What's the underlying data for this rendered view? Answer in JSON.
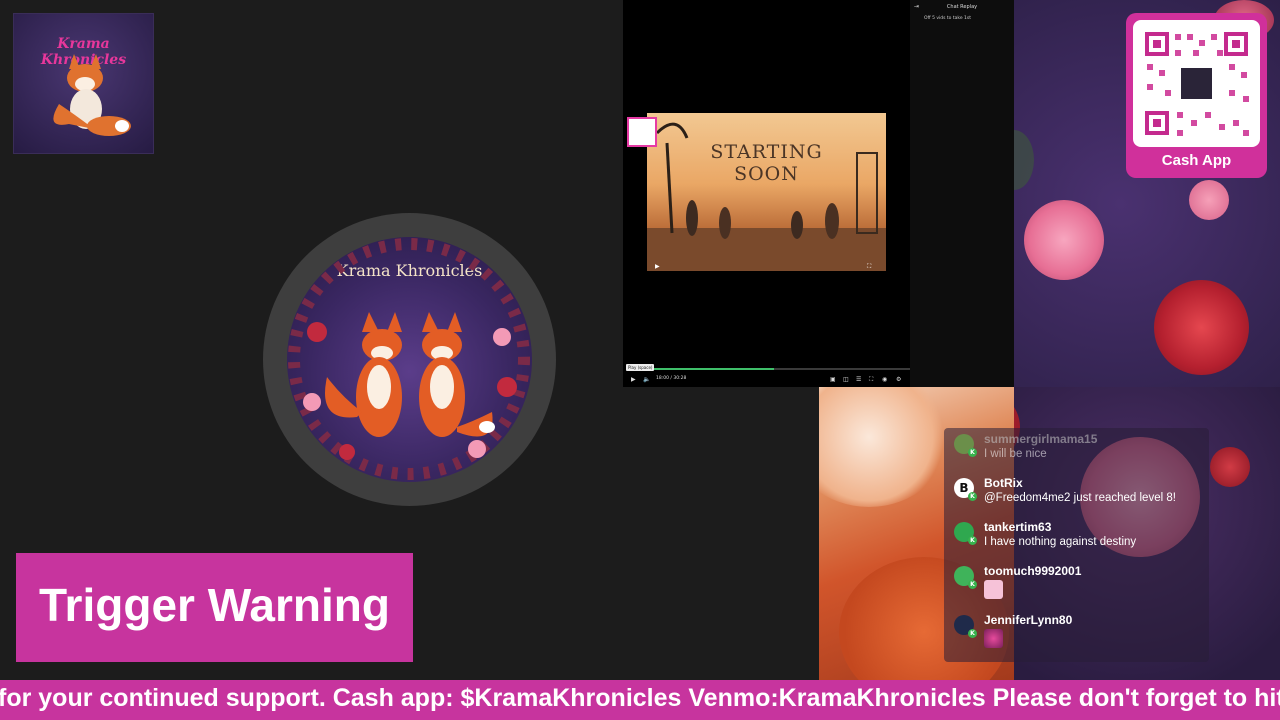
{
  "logo": {
    "text": "Krama Khronicles"
  },
  "avatar": {
    "title": "Krama Khronicles"
  },
  "player": {
    "thumbnail_title_line1": "STARTING",
    "thumbnail_title_line2": "SOON",
    "chat_replay_title": "Chat Replay",
    "chat_replay_line": "Off 5 vids to take 1st",
    "tooltip": "Play (space)",
    "time": "18:00 / 30:28",
    "progress_fraction": 0.52
  },
  "cash_app": {
    "label": "Cash App"
  },
  "chat": {
    "messages": [
      {
        "user": "summergirlmama15",
        "text": "I will be nice",
        "avatar_color": "#6b8f4a"
      },
      {
        "user": "BotRix",
        "text": "@Freedom4me2 just reached level 8!",
        "avatar_color": "#ffffff"
      },
      {
        "user": "tankertim63",
        "text": "I have nothing against destiny",
        "avatar_color": "#2fa84f"
      },
      {
        "user": "toomuch9992001",
        "text": "",
        "avatar_color": "#3fb35a"
      },
      {
        "user": "JenniferLynn80",
        "text": "",
        "avatar_color": "#1f2a4a"
      }
    ]
  },
  "trigger_warning": {
    "text": "Trigger Warning"
  },
  "ticker": {
    "text": "for your continued support. Cash app: $KramaKhronicles Venmo:KramaKhronicles Please don't forget to hit"
  },
  "colors": {
    "accent": "#c7349e",
    "cash_card": "#d0309b",
    "badge": "#37b24d"
  }
}
